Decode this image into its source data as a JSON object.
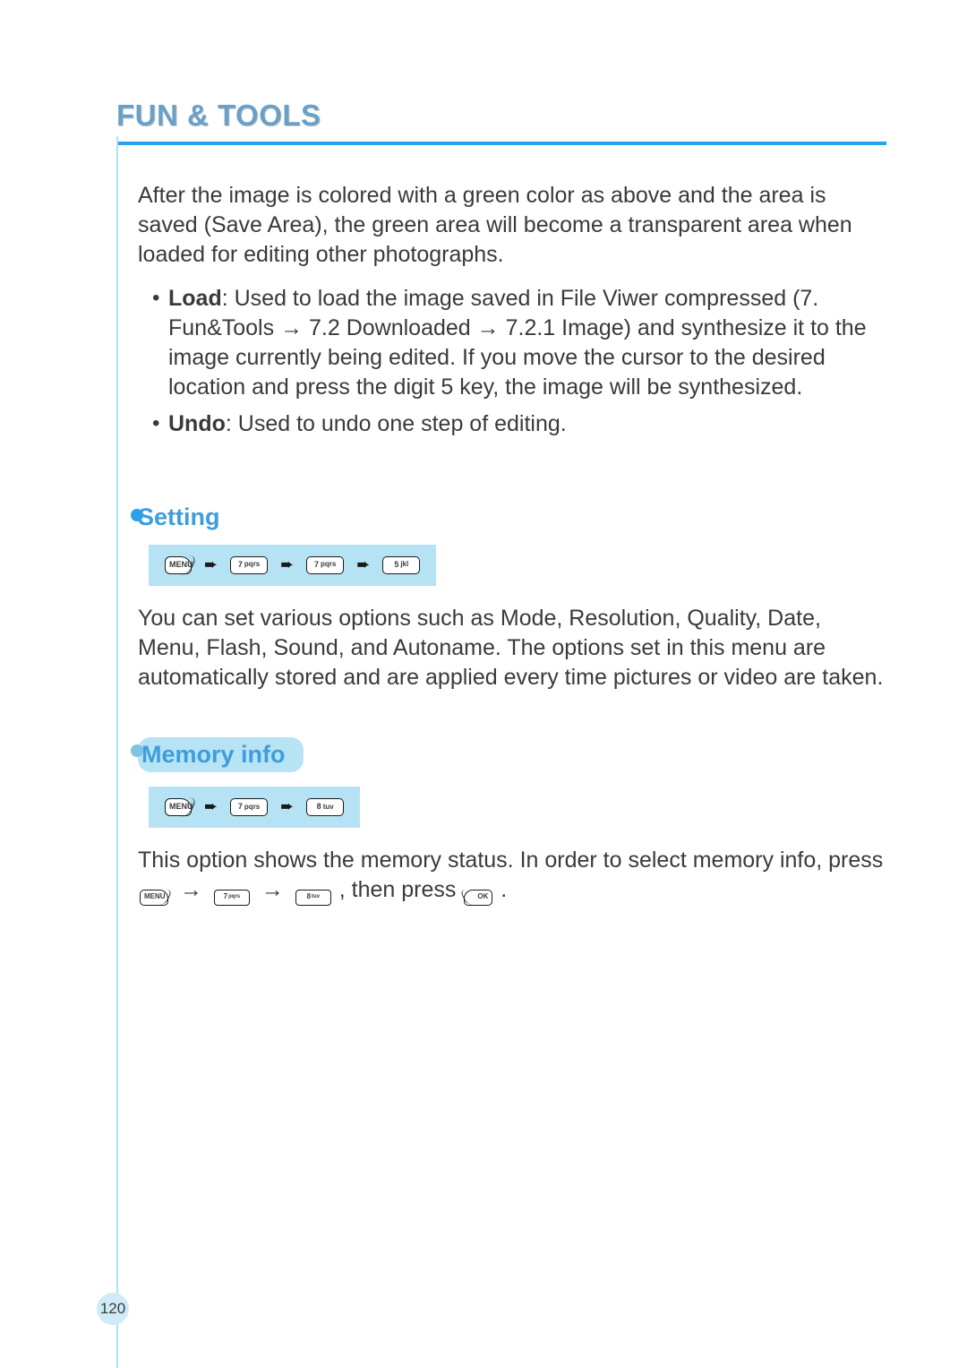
{
  "header": {
    "title": "FUN & TOOLS"
  },
  "intro_paragraph": "After the image is colored with a green color as above and the area is saved (Save Area), the green area will become a transparent area when loaded for editing other photographs.",
  "bullets": {
    "load": {
      "term": "Load",
      "text_before_arrow1": ": Used to load the image saved in File Viwer compressed (7. Fun&Tools ",
      "arrow1": "→",
      "text_mid": " 7.2 Downloaded ",
      "arrow2": "→",
      "text_after": " 7.2.1 Image) and synthesize it to the image currently being edited. If you move the cursor to the desired location and press the digit 5 key, the image will be synthesized."
    },
    "undo": {
      "term": "Undo",
      "text": ": Used to undo one step of editing."
    }
  },
  "section_setting": {
    "title": "Setting",
    "keys": {
      "menu": "MENU",
      "k7": "7",
      "k7sub": "pqrs",
      "k5": "5",
      "k5sub": "jkl"
    },
    "arrow": "➨",
    "text": "You can set various options such as Mode, Resolution, Quality, Date, Menu, Flash, Sound, and Autoname. The options set in this menu are automatically stored and are applied every time pictures or video are taken."
  },
  "section_memory": {
    "title": "Memory info",
    "keys": {
      "menu": "MENU",
      "k7": "7",
      "k7sub": "pqrs",
      "k8": "8",
      "k8sub": "tuv",
      "ok": "OK"
    },
    "arrow": "➨",
    "text_before": "This option shows the memory status. In order to select memory info, press ",
    "text_then": ", then press ",
    "text_end": ".",
    "inline_arrow": "→"
  },
  "page_number": "120"
}
